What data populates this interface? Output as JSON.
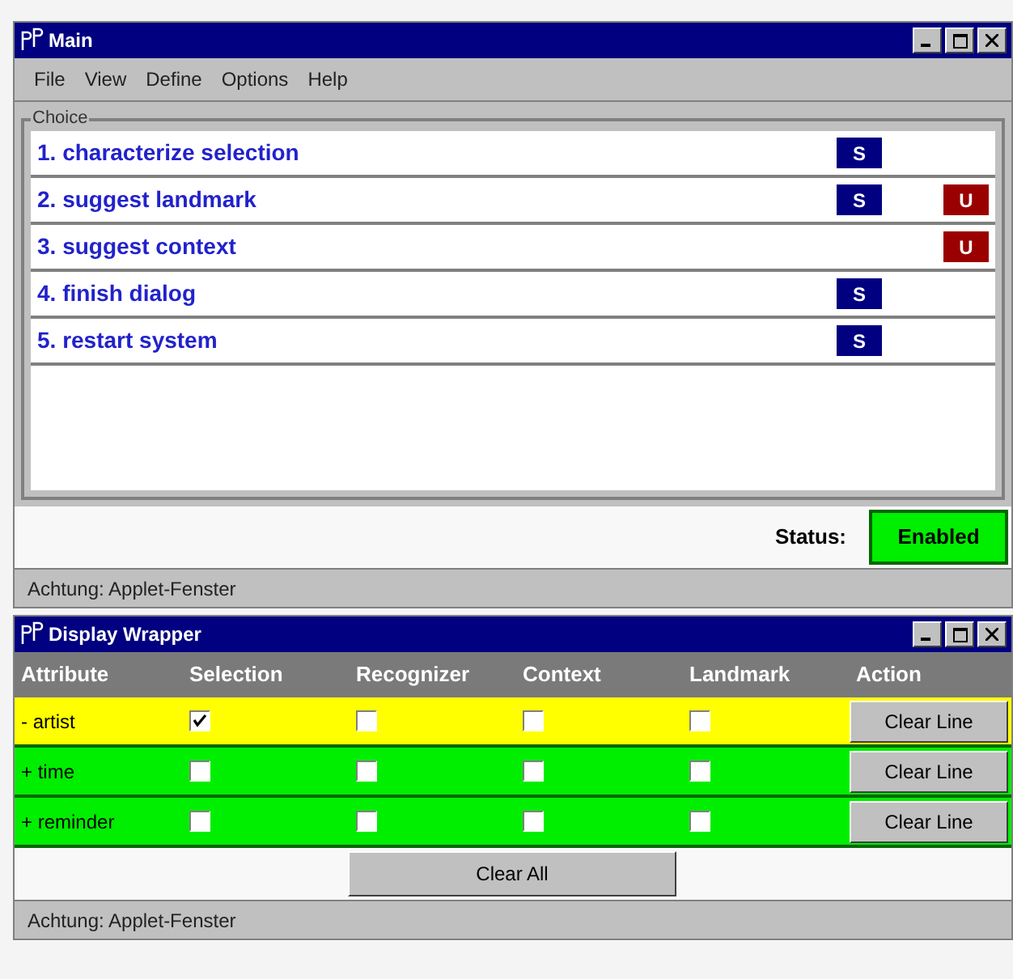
{
  "main_window": {
    "title": "Main",
    "menu": [
      "File",
      "View",
      "Define",
      "Options",
      "Help"
    ],
    "choice": {
      "label": "Choice",
      "items": [
        {
          "text": "1. characterize selection",
          "badges": [
            {
              "kind": "s",
              "label": "S"
            }
          ]
        },
        {
          "text": "2. suggest landmark",
          "badges": [
            {
              "kind": "s",
              "label": "S"
            },
            {
              "kind": "u",
              "label": "U"
            }
          ]
        },
        {
          "text": "3. suggest context",
          "badges": [
            {
              "kind": "u",
              "label": "U"
            }
          ]
        },
        {
          "text": "4. finish dialog",
          "badges": [
            {
              "kind": "s",
              "label": "S"
            }
          ]
        },
        {
          "text": "5. restart system",
          "badges": [
            {
              "kind": "s",
              "label": "S"
            }
          ]
        }
      ]
    },
    "status_label": "Status:",
    "status": {
      "text": "Enabled",
      "enabled": true
    },
    "footer": "Achtung: Applet-Fenster"
  },
  "display_window": {
    "title": "Display Wrapper",
    "columns": [
      "Attribute",
      "Selection",
      "Recognizer",
      "Context",
      "Landmark",
      "Action"
    ],
    "rows": [
      {
        "attribute": "- artist",
        "color": "#ffff00",
        "checks": [
          true,
          false,
          false,
          false
        ],
        "action": "Clear Line"
      },
      {
        "attribute": "+ time",
        "color": "#00ee00",
        "checks": [
          false,
          false,
          false,
          false
        ],
        "action": "Clear Line"
      },
      {
        "attribute": "+ reminder",
        "color": "#00ee00",
        "checks": [
          false,
          false,
          false,
          false
        ],
        "action": "Clear Line"
      }
    ],
    "clear_all": "Clear All",
    "footer": "Achtung: Applet-Fenster"
  }
}
